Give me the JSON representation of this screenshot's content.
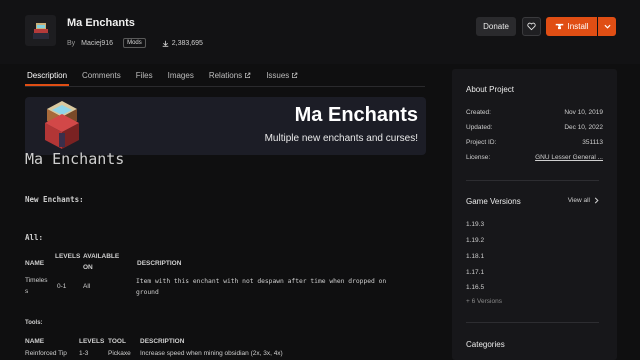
{
  "header": {
    "title": "Ma Enchants",
    "by_label": "By",
    "author": "Maciej916",
    "badge": "Mods",
    "downloads": "2,383,695",
    "donate": "Donate",
    "install": "Install"
  },
  "tabs": [
    {
      "label": "Description",
      "active": true
    },
    {
      "label": "Comments"
    },
    {
      "label": "Files"
    },
    {
      "label": "Images"
    },
    {
      "label": "Relations"
    },
    {
      "label": "Issues"
    }
  ],
  "banner": {
    "title": "Ma Enchants",
    "subtitle": "Multiple new enchants and curses!"
  },
  "description": {
    "heading": "Ma Enchants",
    "new_enchants": "New Enchants:",
    "all_label": "All:",
    "table1": {
      "headers": [
        "NAME",
        "LEVELS",
        "AVAILABLE",
        "ON",
        "DESCRIPTION"
      ],
      "row": {
        "name_line1": "Timeles",
        "name_line2": "s",
        "levels": "0-1",
        "available": "All",
        "desc_line1": "Item with this enchant with not despawn after time when dropped on",
        "desc_line2": "ground"
      }
    },
    "tools_label": "Tools:",
    "table2": {
      "headers": [
        "NAME",
        "LEVELS",
        "TOOL",
        "DESCRIPTION"
      ],
      "row": {
        "name": "Reinforced Tip",
        "levels": "1-3",
        "tool": "Pickaxe",
        "desc": "Increase speed when mining obsidian (2x, 3x, 4x)"
      }
    }
  },
  "sidebar": {
    "about_title": "About Project",
    "created_label": "Created:",
    "created_value": "Nov 10, 2019",
    "updated_label": "Updated:",
    "updated_value": "Dec 10, 2022",
    "project_id_label": "Project ID:",
    "project_id_value": "351113",
    "license_label": "License:",
    "license_value": "GNU Lesser General ...",
    "game_versions_title": "Game Versions",
    "view_all": "View all",
    "versions": [
      "1.19.3",
      "1.19.2",
      "1.18.1",
      "1.17.1",
      "1.16.5"
    ],
    "more_versions": "+ 6 Versions",
    "categories_title": "Categories"
  },
  "colors": {
    "accent": "#e04e14",
    "background": "#0f0f10",
    "sidebar_bg": "#17171a",
    "banner_bg": "#1c1d26"
  }
}
